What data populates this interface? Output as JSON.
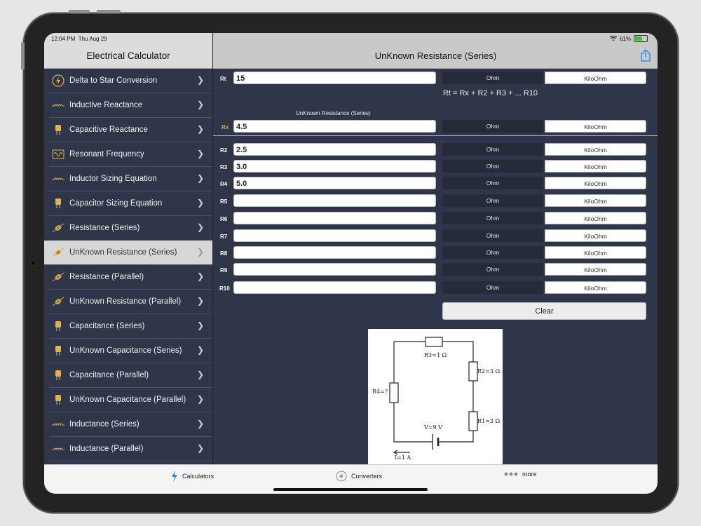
{
  "status": {
    "time": "12:04 PM",
    "date": "Thu Aug 29",
    "battery": "61%",
    "battery_level": 0.61
  },
  "sidebar": {
    "title": "Electrical Calculator",
    "items": [
      {
        "label": "Delta to Star Conversion",
        "icon": "bolt-circle-icon"
      },
      {
        "label": "Inductive Reactance",
        "icon": "inductor-icon"
      },
      {
        "label": "Capacitive Reactance",
        "icon": "capacitor-icon"
      },
      {
        "label": "Resonant Frequency",
        "icon": "oscilloscope-icon"
      },
      {
        "label": "Inductor Sizing Equation",
        "icon": "inductor-icon"
      },
      {
        "label": "Capacitor Sizing Equation",
        "icon": "capacitor-icon"
      },
      {
        "label": "Resistance (Series)",
        "icon": "resistor-icon"
      },
      {
        "label": "UnKnown Resistance (Series)",
        "icon": "resistor-icon",
        "selected": true
      },
      {
        "label": "Resistance (Parallel)",
        "icon": "resistor-icon"
      },
      {
        "label": "UnKnown Resistance (Parallel)",
        "icon": "resistor-icon"
      },
      {
        "label": "Capacitance (Series)",
        "icon": "capacitor-icon"
      },
      {
        "label": "UnKnown Capacitance (Series)",
        "icon": "capacitor-icon"
      },
      {
        "label": "Capacitance (Parallel)",
        "icon": "capacitor-icon"
      },
      {
        "label": "UnKnown Capacitance (Parallel)",
        "icon": "capacitor-icon"
      },
      {
        "label": "Inductance (Series)",
        "icon": "inductor-icon"
      },
      {
        "label": "Inductance (Parallel)",
        "icon": "inductor-icon"
      }
    ]
  },
  "main": {
    "title": "UnKnown Resistance (Series)",
    "formula": "Rt = Rx + R2 + R3 + ... R10",
    "rx_caption": "UnKnown Resistance (Series)",
    "unit_ohm": "Ohm",
    "unit_kilo": "KiloOhm",
    "rt": {
      "label": "Rt",
      "value": "15"
    },
    "rx": {
      "label": "Rx",
      "value": "4.5"
    },
    "resistors": [
      {
        "label": "R2",
        "value": "2.5"
      },
      {
        "label": "R3",
        "value": "3.0"
      },
      {
        "label": "R4",
        "value": "5.0"
      },
      {
        "label": "R5",
        "value": ""
      },
      {
        "label": "R6",
        "value": ""
      },
      {
        "label": "R7",
        "value": ""
      },
      {
        "label": "R8",
        "value": ""
      },
      {
        "label": "R9",
        "value": ""
      },
      {
        "label": "R10",
        "value": ""
      }
    ],
    "clear_label": "Clear",
    "figure": {
      "r3": "R3=1 Ω",
      "r2": "R2=3 Ω",
      "r1": "R1=3 Ω",
      "r4": "R4=?",
      "v": "V=9 V",
      "i": "I=1 A"
    }
  },
  "tabs": [
    {
      "label": "Calculators",
      "icon": "bolt-icon"
    },
    {
      "label": "Converters",
      "icon": "bolt-circle-icon"
    },
    {
      "label": "more",
      "icon": "more-dots-icon"
    }
  ],
  "colors": {
    "accent": "#e4b04a",
    "panel": "#2f3649",
    "unit_dark": "#262b39"
  }
}
